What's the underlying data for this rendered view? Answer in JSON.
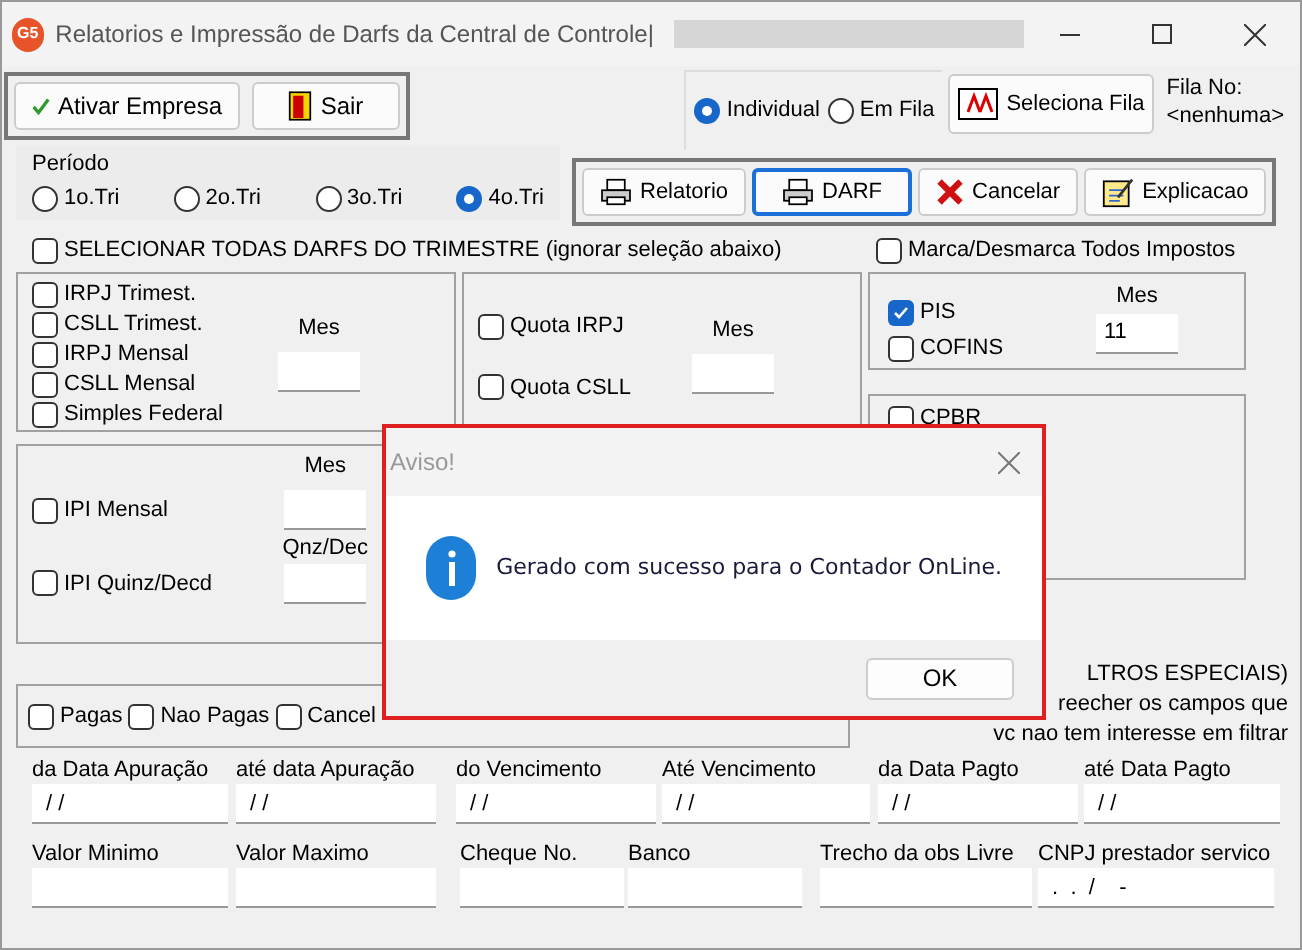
{
  "window": {
    "title": "Relatorios e Impressão de Darfs da Central de Controle|",
    "app_icon": "G5"
  },
  "top_buttons": [
    {
      "label": "Ativar Empresa"
    },
    {
      "label": "Sair"
    }
  ],
  "mode_radios": [
    {
      "label": "Individual",
      "selected": true
    },
    {
      "label": "Em Fila",
      "selected": false
    }
  ],
  "queue_button": {
    "label": "Seleciona Fila"
  },
  "queue_info": {
    "label": "Fila No:",
    "value": "<nenhuma>"
  },
  "period": {
    "title": "Período",
    "options": [
      {
        "label": "1o.Tri",
        "selected": false
      },
      {
        "label": "2o.Tri",
        "selected": false
      },
      {
        "label": "3o.Tri",
        "selected": false
      },
      {
        "label": "4o.Tri",
        "selected": true
      }
    ]
  },
  "action_buttons": [
    {
      "label": "Relatorio",
      "focused": false
    },
    {
      "label": "DARF",
      "focused": true
    },
    {
      "label": "Cancelar",
      "focused": false
    },
    {
      "label": "Explicacao",
      "focused": false
    }
  ],
  "select_all": {
    "label": "SELECIONAR TODAS DARFS DO TRIMESTRE (ignorar seleção abaixo)",
    "checked": false
  },
  "toggle_all_taxes": {
    "label": "Marca/Desmarca Todos Impostos",
    "checked": false
  },
  "irpj_panel": {
    "items": [
      {
        "label": "IRPJ Trimest.",
        "checked": false
      },
      {
        "label": "CSLL Trimest.",
        "checked": false
      },
      {
        "label": "IRPJ Mensal",
        "checked": false
      },
      {
        "label": "CSLL Mensal",
        "checked": false
      },
      {
        "label": "Simples Federal",
        "checked": false
      }
    ],
    "month_label": "Mes"
  },
  "quota_panel": {
    "items": [
      {
        "label": "Quota IRPJ",
        "checked": false
      },
      {
        "label": "Quota CSLL",
        "checked": false
      }
    ],
    "month_label": "Mes"
  },
  "pis_panel": {
    "items": [
      {
        "label": "PIS",
        "checked": true
      },
      {
        "label": "COFINS",
        "checked": false
      }
    ],
    "month_label": "Mes",
    "month_value": "11"
  },
  "ipi_panel": {
    "items": [
      {
        "label": "IPI Mensal",
        "checked": false
      },
      {
        "label": "IPI Quinz/Decd",
        "checked": false
      }
    ],
    "month_label": "Mes",
    "period_label": "Qnz/Dec"
  },
  "cpbr_panel": {
    "items": [
      {
        "label": "CPBR",
        "checked": false
      }
    ]
  },
  "status_filter": [
    {
      "label": "Pagas",
      "checked": false
    },
    {
      "label": "Nao Pagas",
      "checked": false
    },
    {
      "label": "Cancel",
      "checked": false
    }
  ],
  "filter_note": [
    "LTROS ESPECIAIS)",
    "reecher os campos que",
    "vc nao tem interesse em filtrar"
  ],
  "date_fields": [
    {
      "label": "da Data Apuração",
      "value": " / /"
    },
    {
      "label": "até data Apuração",
      "value": " / /"
    },
    {
      "label": "do Vencimento",
      "value": " / /"
    },
    {
      "label": "Até Vencimento",
      "value": " / /"
    },
    {
      "label": "da Data Pagto",
      "value": " / /"
    },
    {
      "label": "até Data Pagto",
      "value": " / /"
    }
  ],
  "other_fields": [
    {
      "label": "Valor Minimo"
    },
    {
      "label": "Valor Maximo"
    },
    {
      "label": "Cheque No."
    },
    {
      "label": "Banco"
    },
    {
      "label": "Trecho da obs Livre"
    },
    {
      "label": "CNPJ prestador servico",
      "value": " .  .  /    -"
    }
  ],
  "dialog": {
    "title": "Aviso!",
    "message": "Gerado com sucesso para o Contador OnLine.",
    "ok": "OK"
  }
}
